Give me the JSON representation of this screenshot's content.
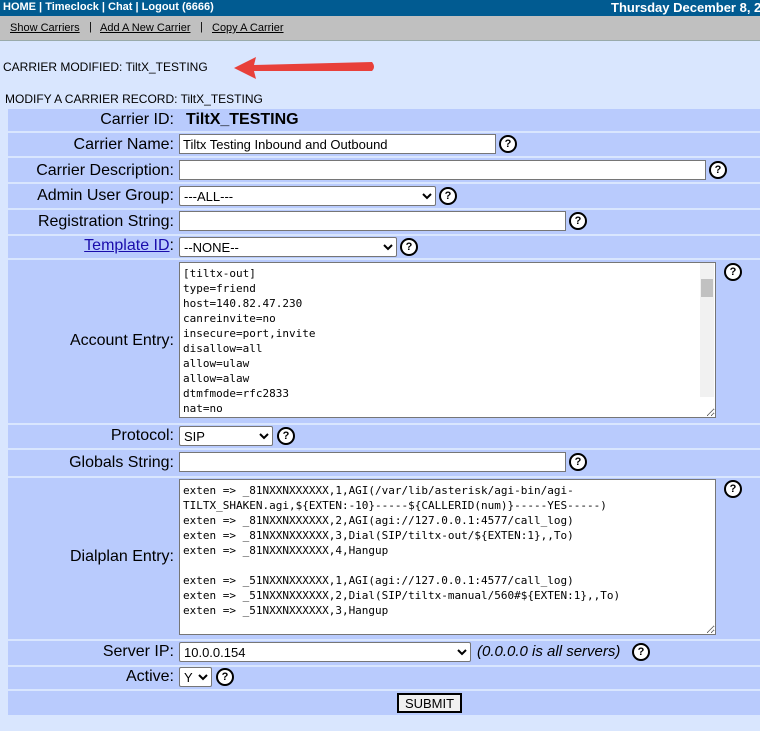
{
  "topbar": {
    "links": [
      "HOME",
      "Timeclock",
      "Chat",
      "Logout (6666)"
    ],
    "separators": " | ",
    "date": "Thursday December 8, 2"
  },
  "subnav": {
    "show_carriers": "Show Carriers",
    "add_carrier": "Add A New Carrier",
    "copy_carrier": "Copy A Carrier",
    "sep": "|"
  },
  "message": "CARRIER MODIFIED: TiltX_TESTING",
  "form_title": "MODIFY A CARRIER RECORD: TiltX_TESTING",
  "form": {
    "carrier_id_label": "Carrier ID:",
    "carrier_id_value": "TiltX_TESTING",
    "carrier_name_label": "Carrier Name:",
    "carrier_name_value": "Tiltx Testing Inbound and Outbound",
    "description_label": "Carrier Description:",
    "description_value": "",
    "admin_group_label": "Admin User Group:",
    "admin_group_value": "---ALL---",
    "registration_label": "Registration String:",
    "registration_value": "",
    "template_label": "Template ID",
    "template_colon": ":",
    "template_value": "--NONE--",
    "account_label": "Account Entry:",
    "account_value": "[tiltx-out]\ntype=friend\nhost=140.82.47.230\ncanreinvite=no\ninsecure=port,invite\ndisallow=all\nallow=ulaw\nallow=alaw\ndtmfmode=rfc2833\nnat=no",
    "protocol_label": "Protocol:",
    "protocol_value": "SIP",
    "globals_label": "Globals String:",
    "globals_value": "",
    "dialplan_label": "Dialplan Entry:",
    "dialplan_value": "exten => _81NXXNXXXXXX,1,AGI(/var/lib/asterisk/agi-bin/agi-\nTILTX_SHAKEN.agi,${EXTEN:-10}-----${CALLERID(num)}-----YES-----)\nexten => _81NXXNXXXXXX,2,AGI(agi://127.0.0.1:4577/call_log)\nexten => _81NXXNXXXXXX,3,Dial(SIP/tiltx-out/${EXTEN:1},,To)\nexten => _81NXXNXXXXXX,4,Hangup\n\nexten => _51NXXNXXXXXX,1,AGI(agi://127.0.0.1:4577/call_log)\nexten => _51NXXNXXXXXX,2,Dial(SIP/tiltx-manual/560#${EXTEN:1},,To)\nexten => _51NXXNXXXXXX,3,Hangup",
    "server_ip_label": "Server IP:",
    "server_ip_value": "10.0.0.154",
    "server_note": "(0.0.0.0 is all servers)",
    "active_label": "Active:",
    "active_value": "Y",
    "submit_label": "SUBMIT",
    "help_glyph": "?"
  },
  "colors": {
    "topbar": "#015b91",
    "subnav": "#c0c0c0",
    "page_bg": "#d9e6fe",
    "row_bg": "#b9cbfd",
    "arrow": "#e8403a"
  }
}
